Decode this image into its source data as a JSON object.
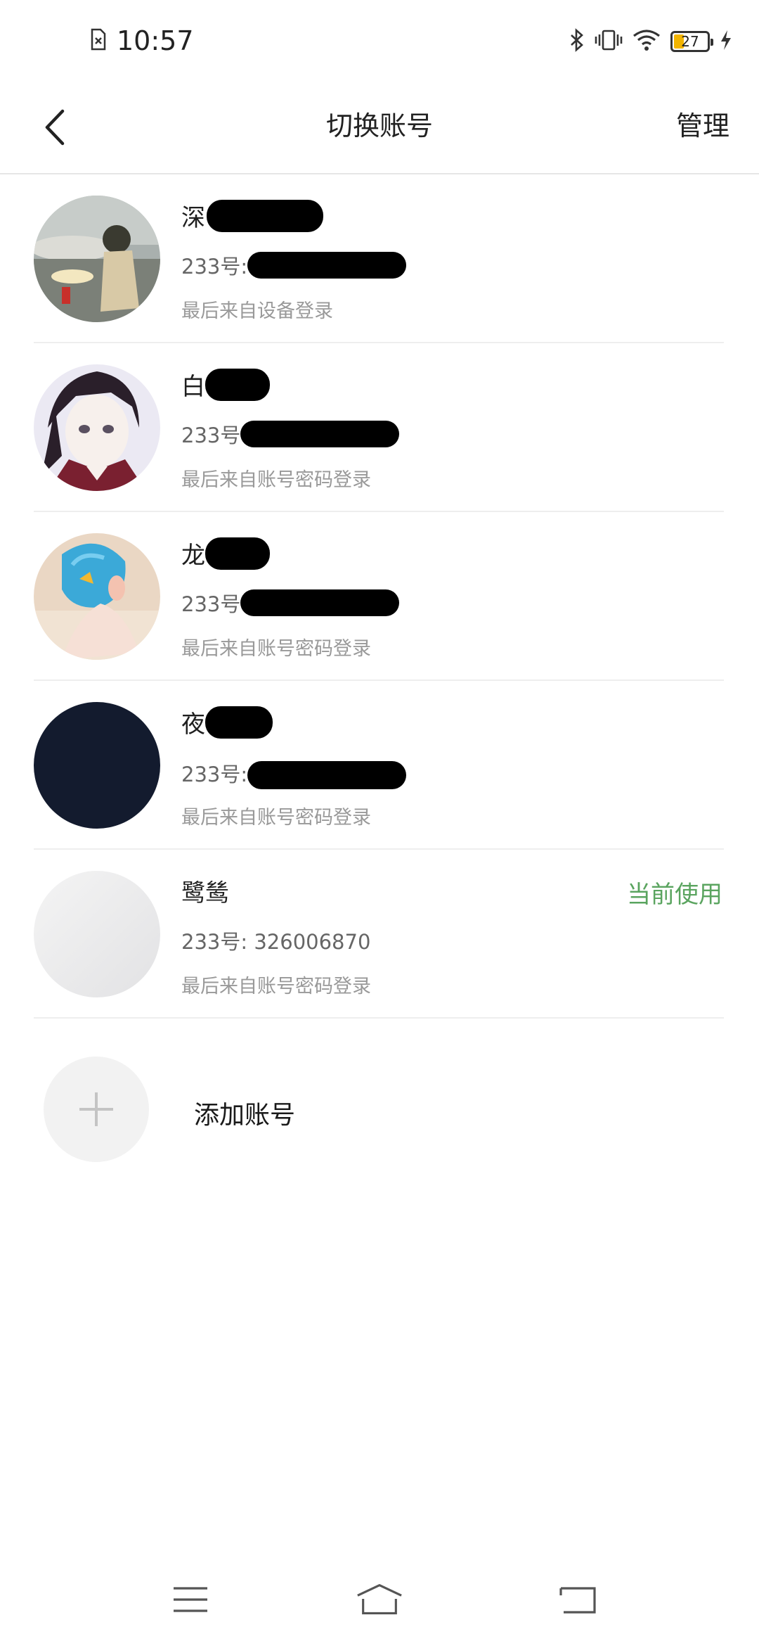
{
  "status_bar": {
    "time": "10:57",
    "battery_level": "27",
    "icons": [
      "sim-off-icon",
      "bluetooth-icon",
      "vibrate-icon",
      "wifi-icon",
      "battery-icon",
      "charging-icon"
    ]
  },
  "nav": {
    "title": "切换账号",
    "manage_label": "管理",
    "back_icon": "back-chevron-icon"
  },
  "accounts": [
    {
      "name": "深",
      "uid": "233号:",
      "last_login": "最后来自设备登录",
      "avatar_color": "#9aa0a0",
      "current": false
    },
    {
      "name": "白",
      "uid": "233号",
      "last_login": "最后来自账号密码登录",
      "avatar_color": "#e8e6f0",
      "current": false
    },
    {
      "name": "龙",
      "uid": "233号",
      "last_login": "最后来自账号密码登录",
      "avatar_color": "#e2c6ae",
      "current": false
    },
    {
      "name": "夜",
      "uid": "233号:",
      "last_login": "最后来自账号密码登录",
      "avatar_color": "#131b2e",
      "current": false
    },
    {
      "name": "鹭鸶",
      "uid": "233号: 326006870",
      "last_login": "最后来自账号密码登录",
      "avatar_color": "#ececec",
      "current": true,
      "current_label": "当前使用",
      "current_color": "#5aa45f"
    }
  ],
  "add_account": {
    "label": "添加账号",
    "icon": "plus-icon"
  },
  "system_nav": [
    "menu-icon",
    "home-icon",
    "return-icon"
  ]
}
